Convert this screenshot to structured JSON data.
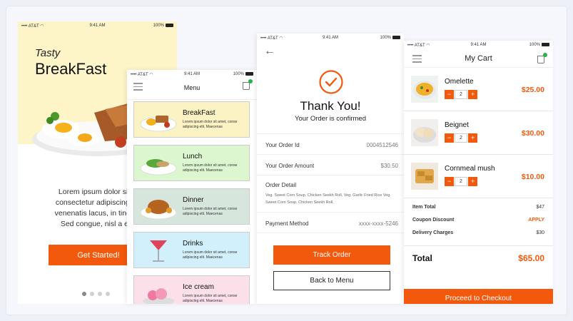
{
  "status_bar": {
    "carrier": "•••• AT&T ◠",
    "time": "9:41 AM",
    "battery": "100%"
  },
  "onboarding": {
    "tasty": "Tasty",
    "title": "BreakFast",
    "body_lines": [
      "Lorem ipsum dolor sit a",
      "consectetur adipiscing eli",
      "venenatis lacus, in tincidu",
      "Sed congue, nisl a ele"
    ],
    "cta": "Get Started!",
    "pages": 4,
    "active_page": 1
  },
  "menu": {
    "title": "Menu",
    "categories": [
      {
        "name": "BreakFast",
        "desc": "Lorem ipsum dolor sit amet, conse adipiscing elit. Maecenas",
        "bg": "#fcf3c4",
        "icon": "breakfast-plate"
      },
      {
        "name": "Lunch",
        "desc": "Lorem ipsum dolor sit amet, conse adipiscing elit. Maecenas",
        "bg": "#dcf7cf",
        "icon": "lunch-plate"
      },
      {
        "name": "Dinner",
        "desc": "Lorem ipsum dolor sit amet, conse adipiscing elit. Maecenas",
        "bg": "#d7e6dd",
        "icon": "roast-chicken"
      },
      {
        "name": "Drinks",
        "desc": "Lorem ipsum dolor sit amet, conse adipiscing elit. Maecenas",
        "bg": "#d2f0fb",
        "icon": "cocktail-glass"
      },
      {
        "name": "Ice cream",
        "desc": "Lorem ipsum dolor sit amet, conse adipiscing elit. Maecenas",
        "bg": "#fbe0ea",
        "icon": "ice-cream-bowl"
      }
    ]
  },
  "confirmation": {
    "title": "Thank You!",
    "subtitle": "Your Order is confirmed",
    "order_id_label": "Your Order Id",
    "order_id": "0004512546",
    "amount_label": "Your Order Amount",
    "amount": "$30.50",
    "detail_label": "Order Detail",
    "detail_text": "Veg. Sweet Corn Soup, Chicken Seekh Roll, Veg. Garlic Fried Rice Veg. Sweet Corn Soup, Chicken Seekh Roll,",
    "payment_label": "Payment Method",
    "payment_value": "xxxx-xxxx-5246",
    "track_label": "Track Order",
    "back_label": "Back to Menu"
  },
  "cart": {
    "title": "My Cart",
    "items": [
      {
        "name": "Omelette",
        "qty": "2",
        "price": "$25.00",
        "icon": "omelette-dish"
      },
      {
        "name": "Beignet",
        "qty": "2",
        "price": "$30.00",
        "icon": "beignet-dish"
      },
      {
        "name": "Cornmeal mush",
        "qty": "2",
        "price": "$10.00",
        "icon": "cornmeal-dish"
      }
    ],
    "item_total_label": "Item Total",
    "item_total": "$47",
    "coupon_label": "Coupon Discount",
    "coupon_value": "APPLY",
    "delivery_label": "Delivery Charges",
    "delivery_value": "$30",
    "total_label": "Total",
    "total": "$65.00",
    "checkout_label": "Proceed to Checkout",
    "accent": "#f2590d"
  }
}
